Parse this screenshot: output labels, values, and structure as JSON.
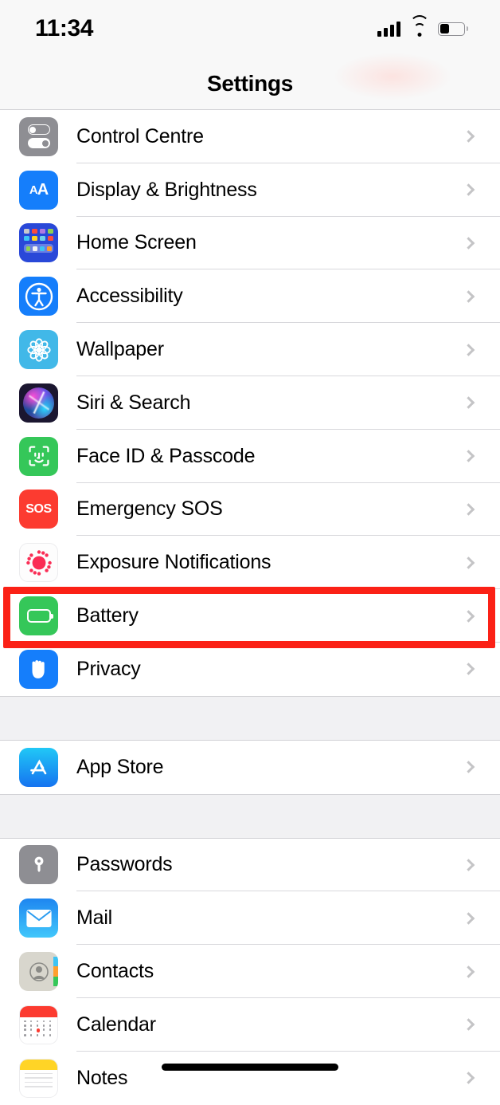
{
  "status_bar": {
    "time": "11:34",
    "signal_icon": "cellular-signal-icon",
    "wifi_icon": "wifi-icon",
    "battery_icon": "battery-icon",
    "battery_level_percent": 40
  },
  "nav": {
    "title": "Settings"
  },
  "highlight": {
    "target_row": "Battery",
    "color": "#fb2116"
  },
  "groups": [
    {
      "rows": [
        {
          "label": "Control Centre",
          "icon": "control-centre-icon"
        },
        {
          "label": "Display & Brightness",
          "icon": "display-brightness-icon"
        },
        {
          "label": "Home Screen",
          "icon": "home-screen-icon"
        },
        {
          "label": "Accessibility",
          "icon": "accessibility-icon"
        },
        {
          "label": "Wallpaper",
          "icon": "wallpaper-icon"
        },
        {
          "label": "Siri & Search",
          "icon": "siri-search-icon"
        },
        {
          "label": "Face ID & Passcode",
          "icon": "face-id-icon"
        },
        {
          "label": "Emergency SOS",
          "icon": "emergency-sos-icon"
        },
        {
          "label": "Exposure Notifications",
          "icon": "exposure-notifications-icon"
        },
        {
          "label": "Battery",
          "icon": "battery-settings-icon"
        },
        {
          "label": "Privacy",
          "icon": "privacy-icon"
        }
      ]
    },
    {
      "rows": [
        {
          "label": "App Store",
          "icon": "app-store-icon"
        }
      ]
    },
    {
      "rows": [
        {
          "label": "Passwords",
          "icon": "passwords-icon"
        },
        {
          "label": "Mail",
          "icon": "mail-icon"
        },
        {
          "label": "Contacts",
          "icon": "contacts-icon"
        },
        {
          "label": "Calendar",
          "icon": "calendar-icon"
        },
        {
          "label": "Notes",
          "icon": "notes-icon"
        }
      ]
    }
  ],
  "chevron_icon": "chevron-right-icon",
  "sos_text": "SOS",
  "display_icon_text": {
    "big": "A",
    "small": "A"
  }
}
